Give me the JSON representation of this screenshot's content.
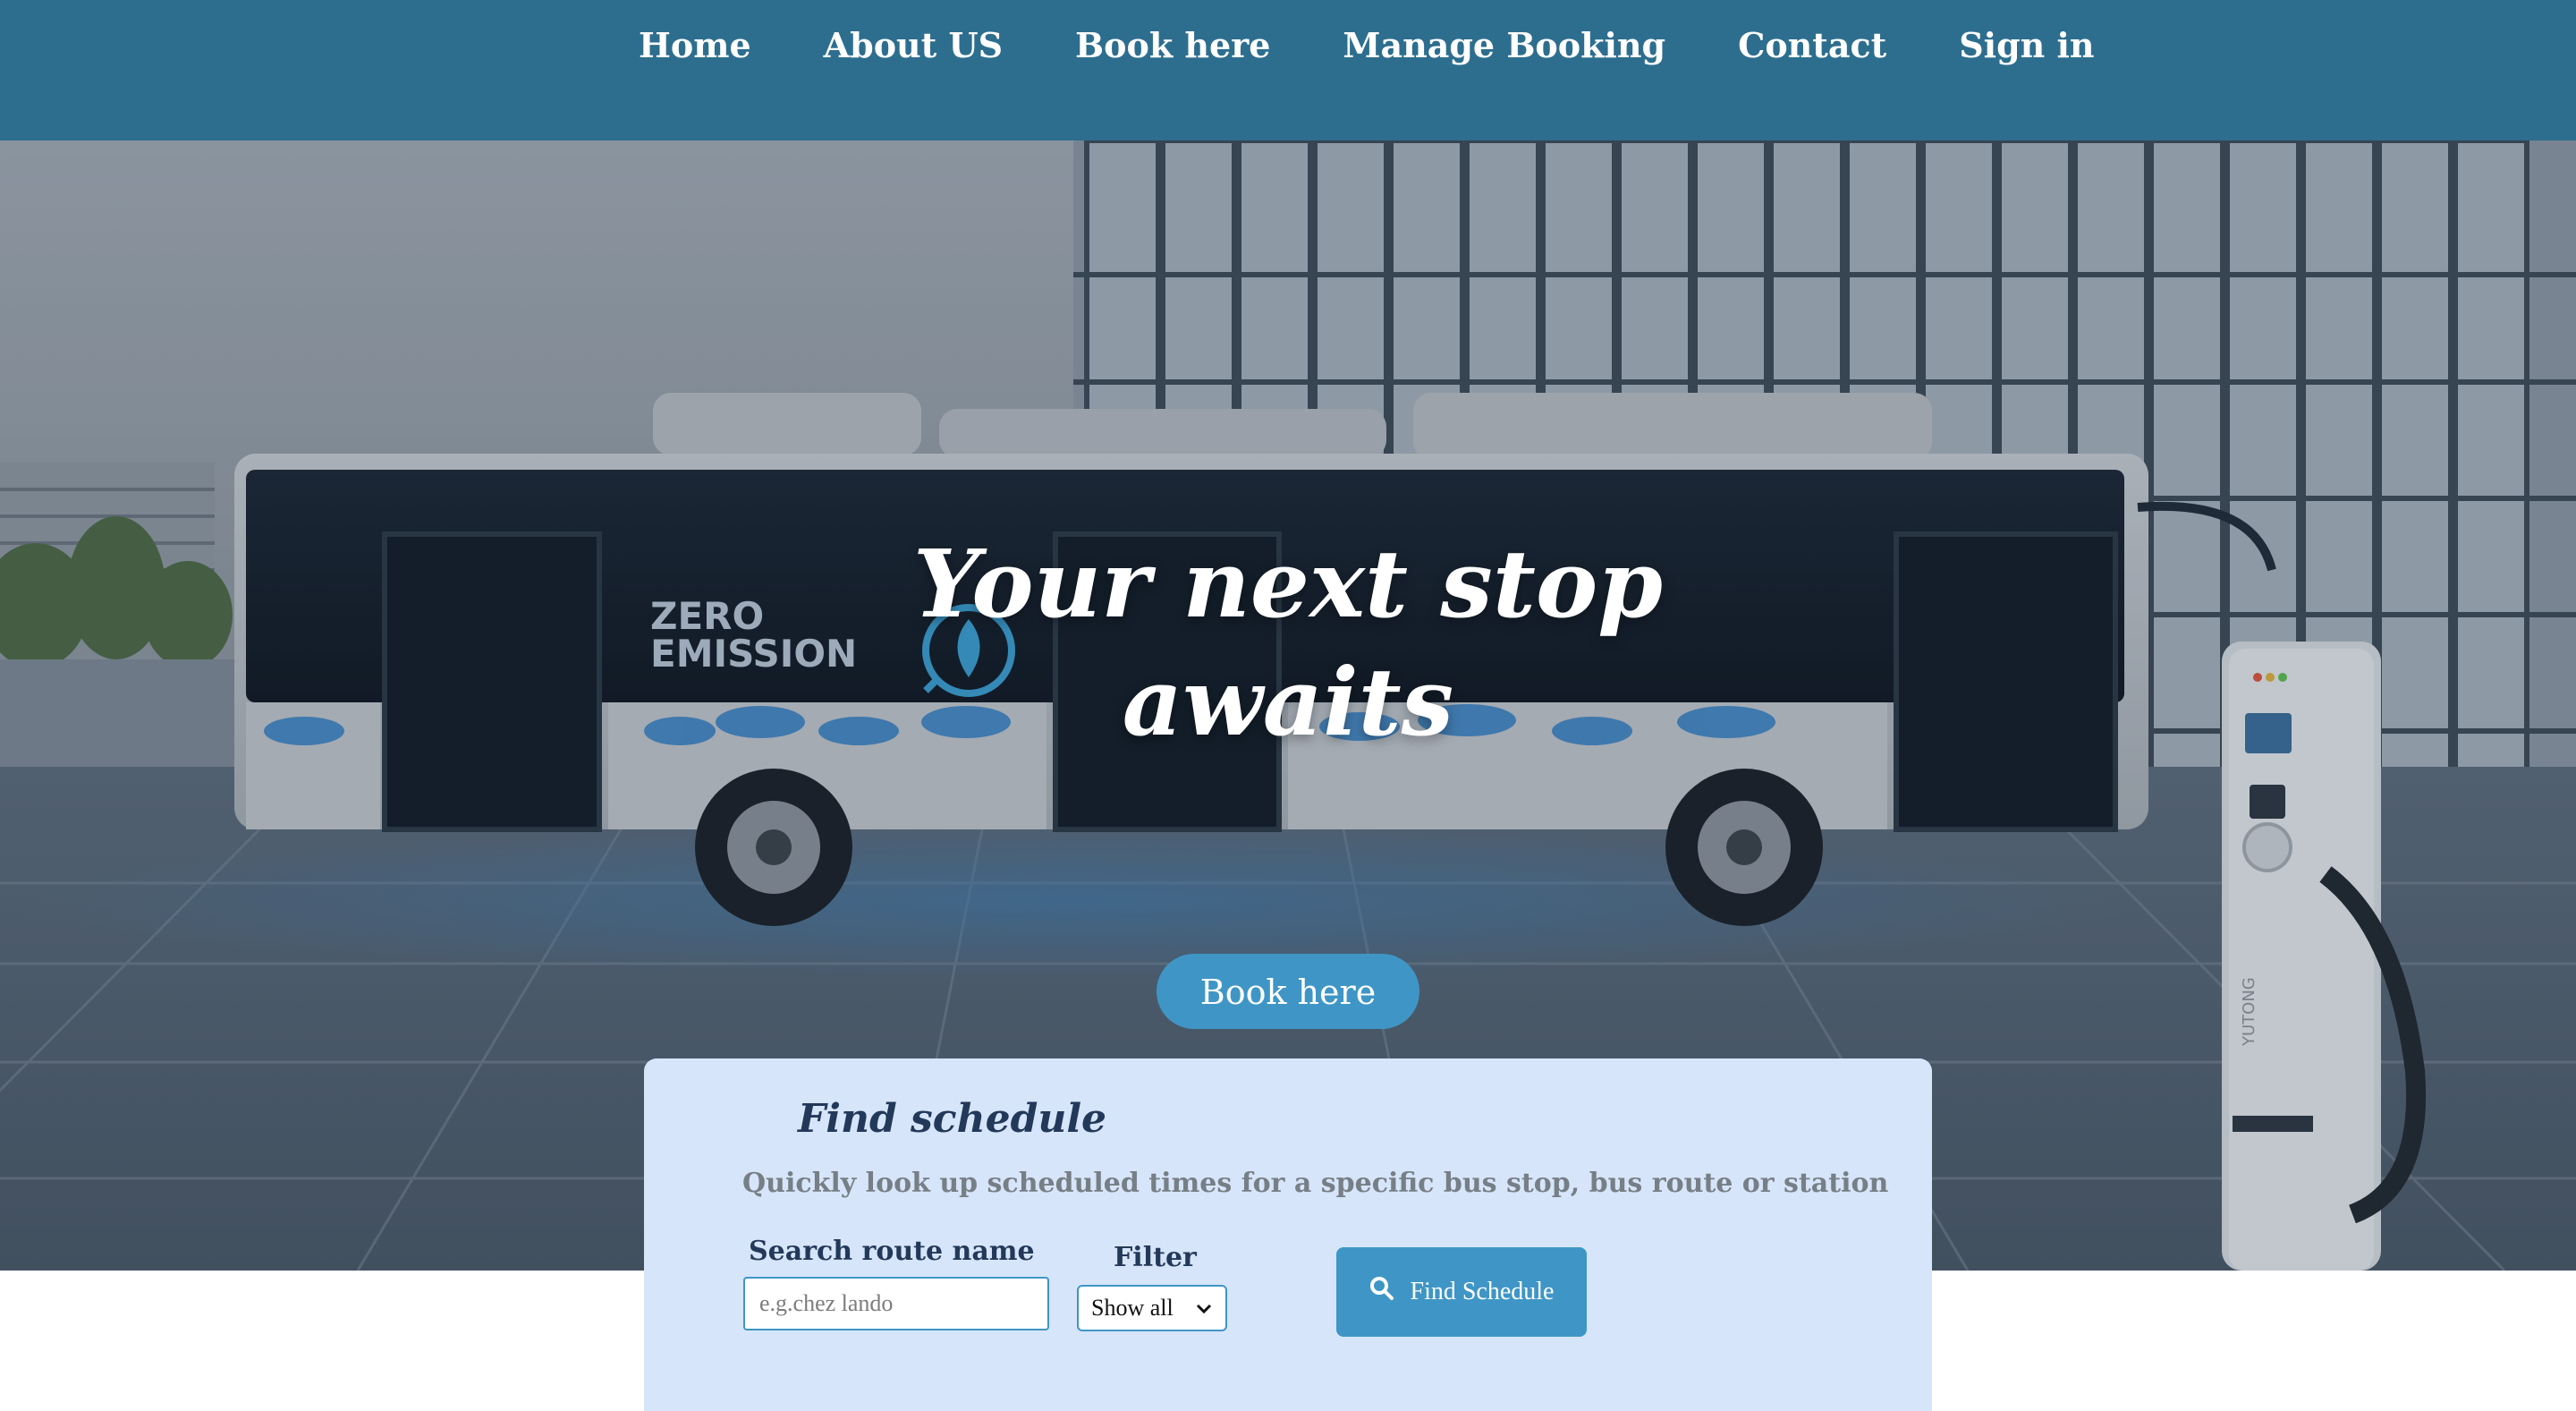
{
  "nav": {
    "items": [
      {
        "label": "Home"
      },
      {
        "label": "About US"
      },
      {
        "label": "Book here"
      },
      {
        "label": "Manage Booking"
      },
      {
        "label": "Contact"
      },
      {
        "label": "Sign in"
      }
    ]
  },
  "hero": {
    "title_line1": "Your next stop",
    "title_line2": "awaits",
    "book_button": "Book here",
    "bus_badge_line1": "ZERO",
    "bus_badge_line2": "EMISSION",
    "charger_brand": "YUTONG"
  },
  "schedule": {
    "title": "Find schedule",
    "subtitle": "Quickly look up scheduled times for a specific bus stop, bus route or station",
    "search_label": "Search route name",
    "search_placeholder": "e.g.chez lando",
    "search_value": "",
    "filter_label": "Filter",
    "filter_selected": "Show all",
    "find_button": "Find Schedule"
  },
  "colors": {
    "nav_bg": "#2d6e8f",
    "accent": "#3f96c6",
    "card_bg": "#d6e5f9",
    "heading": "#23395a"
  },
  "icons": {
    "search": "search-icon",
    "dropdown": "chevron-down-icon",
    "leaf_plug": "leaf-plug-icon"
  }
}
